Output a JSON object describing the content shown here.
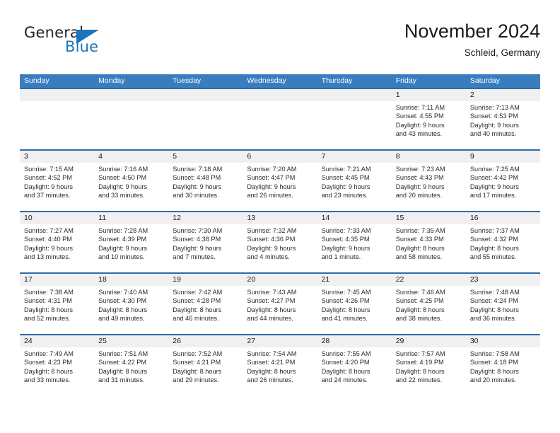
{
  "logo": {
    "text_top": "General",
    "text_bottom": "Blue",
    "triangle_color": "#1b75bb",
    "top_color": "#231f20"
  },
  "header": {
    "title": "November 2024",
    "subtitle": "Schleid, Germany"
  },
  "colors": {
    "header_blue": "#3a7dbf",
    "row_border_blue": "#2d6ca8",
    "day_band_gray": "#f0f0f0"
  },
  "weekdays": [
    "Sunday",
    "Monday",
    "Tuesday",
    "Wednesday",
    "Thursday",
    "Friday",
    "Saturday"
  ],
  "weeks": [
    [
      {
        "day": "",
        "sunrise": "",
        "sunset": "",
        "daylight1": "",
        "daylight2": ""
      },
      {
        "day": "",
        "sunrise": "",
        "sunset": "",
        "daylight1": "",
        "daylight2": ""
      },
      {
        "day": "",
        "sunrise": "",
        "sunset": "",
        "daylight1": "",
        "daylight2": ""
      },
      {
        "day": "",
        "sunrise": "",
        "sunset": "",
        "daylight1": "",
        "daylight2": ""
      },
      {
        "day": "",
        "sunrise": "",
        "sunset": "",
        "daylight1": "",
        "daylight2": ""
      },
      {
        "day": "1",
        "sunrise": "Sunrise: 7:11 AM",
        "sunset": "Sunset: 4:55 PM",
        "daylight1": "Daylight: 9 hours",
        "daylight2": "and 43 minutes."
      },
      {
        "day": "2",
        "sunrise": "Sunrise: 7:13 AM",
        "sunset": "Sunset: 4:53 PM",
        "daylight1": "Daylight: 9 hours",
        "daylight2": "and 40 minutes."
      }
    ],
    [
      {
        "day": "3",
        "sunrise": "Sunrise: 7:15 AM",
        "sunset": "Sunset: 4:52 PM",
        "daylight1": "Daylight: 9 hours",
        "daylight2": "and 37 minutes."
      },
      {
        "day": "4",
        "sunrise": "Sunrise: 7:16 AM",
        "sunset": "Sunset: 4:50 PM",
        "daylight1": "Daylight: 9 hours",
        "daylight2": "and 33 minutes."
      },
      {
        "day": "5",
        "sunrise": "Sunrise: 7:18 AM",
        "sunset": "Sunset: 4:48 PM",
        "daylight1": "Daylight: 9 hours",
        "daylight2": "and 30 minutes."
      },
      {
        "day": "6",
        "sunrise": "Sunrise: 7:20 AM",
        "sunset": "Sunset: 4:47 PM",
        "daylight1": "Daylight: 9 hours",
        "daylight2": "and 26 minutes."
      },
      {
        "day": "7",
        "sunrise": "Sunrise: 7:21 AM",
        "sunset": "Sunset: 4:45 PM",
        "daylight1": "Daylight: 9 hours",
        "daylight2": "and 23 minutes."
      },
      {
        "day": "8",
        "sunrise": "Sunrise: 7:23 AM",
        "sunset": "Sunset: 4:43 PM",
        "daylight1": "Daylight: 9 hours",
        "daylight2": "and 20 minutes."
      },
      {
        "day": "9",
        "sunrise": "Sunrise: 7:25 AM",
        "sunset": "Sunset: 4:42 PM",
        "daylight1": "Daylight: 9 hours",
        "daylight2": "and 17 minutes."
      }
    ],
    [
      {
        "day": "10",
        "sunrise": "Sunrise: 7:27 AM",
        "sunset": "Sunset: 4:40 PM",
        "daylight1": "Daylight: 9 hours",
        "daylight2": "and 13 minutes."
      },
      {
        "day": "11",
        "sunrise": "Sunrise: 7:28 AM",
        "sunset": "Sunset: 4:39 PM",
        "daylight1": "Daylight: 9 hours",
        "daylight2": "and 10 minutes."
      },
      {
        "day": "12",
        "sunrise": "Sunrise: 7:30 AM",
        "sunset": "Sunset: 4:38 PM",
        "daylight1": "Daylight: 9 hours",
        "daylight2": "and 7 minutes."
      },
      {
        "day": "13",
        "sunrise": "Sunrise: 7:32 AM",
        "sunset": "Sunset: 4:36 PM",
        "daylight1": "Daylight: 9 hours",
        "daylight2": "and 4 minutes."
      },
      {
        "day": "14",
        "sunrise": "Sunrise: 7:33 AM",
        "sunset": "Sunset: 4:35 PM",
        "daylight1": "Daylight: 9 hours",
        "daylight2": "and 1 minute."
      },
      {
        "day": "15",
        "sunrise": "Sunrise: 7:35 AM",
        "sunset": "Sunset: 4:33 PM",
        "daylight1": "Daylight: 8 hours",
        "daylight2": "and 58 minutes."
      },
      {
        "day": "16",
        "sunrise": "Sunrise: 7:37 AM",
        "sunset": "Sunset: 4:32 PM",
        "daylight1": "Daylight: 8 hours",
        "daylight2": "and 55 minutes."
      }
    ],
    [
      {
        "day": "17",
        "sunrise": "Sunrise: 7:38 AM",
        "sunset": "Sunset: 4:31 PM",
        "daylight1": "Daylight: 8 hours",
        "daylight2": "and 52 minutes."
      },
      {
        "day": "18",
        "sunrise": "Sunrise: 7:40 AM",
        "sunset": "Sunset: 4:30 PM",
        "daylight1": "Daylight: 8 hours",
        "daylight2": "and 49 minutes."
      },
      {
        "day": "19",
        "sunrise": "Sunrise: 7:42 AM",
        "sunset": "Sunset: 4:28 PM",
        "daylight1": "Daylight: 8 hours",
        "daylight2": "and 46 minutes."
      },
      {
        "day": "20",
        "sunrise": "Sunrise: 7:43 AM",
        "sunset": "Sunset: 4:27 PM",
        "daylight1": "Daylight: 8 hours",
        "daylight2": "and 44 minutes."
      },
      {
        "day": "21",
        "sunrise": "Sunrise: 7:45 AM",
        "sunset": "Sunset: 4:26 PM",
        "daylight1": "Daylight: 8 hours",
        "daylight2": "and 41 minutes."
      },
      {
        "day": "22",
        "sunrise": "Sunrise: 7:46 AM",
        "sunset": "Sunset: 4:25 PM",
        "daylight1": "Daylight: 8 hours",
        "daylight2": "and 38 minutes."
      },
      {
        "day": "23",
        "sunrise": "Sunrise: 7:48 AM",
        "sunset": "Sunset: 4:24 PM",
        "daylight1": "Daylight: 8 hours",
        "daylight2": "and 36 minutes."
      }
    ],
    [
      {
        "day": "24",
        "sunrise": "Sunrise: 7:49 AM",
        "sunset": "Sunset: 4:23 PM",
        "daylight1": "Daylight: 8 hours",
        "daylight2": "and 33 minutes."
      },
      {
        "day": "25",
        "sunrise": "Sunrise: 7:51 AM",
        "sunset": "Sunset: 4:22 PM",
        "daylight1": "Daylight: 8 hours",
        "daylight2": "and 31 minutes."
      },
      {
        "day": "26",
        "sunrise": "Sunrise: 7:52 AM",
        "sunset": "Sunset: 4:21 PM",
        "daylight1": "Daylight: 8 hours",
        "daylight2": "and 29 minutes."
      },
      {
        "day": "27",
        "sunrise": "Sunrise: 7:54 AM",
        "sunset": "Sunset: 4:21 PM",
        "daylight1": "Daylight: 8 hours",
        "daylight2": "and 26 minutes."
      },
      {
        "day": "28",
        "sunrise": "Sunrise: 7:55 AM",
        "sunset": "Sunset: 4:20 PM",
        "daylight1": "Daylight: 8 hours",
        "daylight2": "and 24 minutes."
      },
      {
        "day": "29",
        "sunrise": "Sunrise: 7:57 AM",
        "sunset": "Sunset: 4:19 PM",
        "daylight1": "Daylight: 8 hours",
        "daylight2": "and 22 minutes."
      },
      {
        "day": "30",
        "sunrise": "Sunrise: 7:58 AM",
        "sunset": "Sunset: 4:18 PM",
        "daylight1": "Daylight: 8 hours",
        "daylight2": "and 20 minutes."
      }
    ]
  ]
}
